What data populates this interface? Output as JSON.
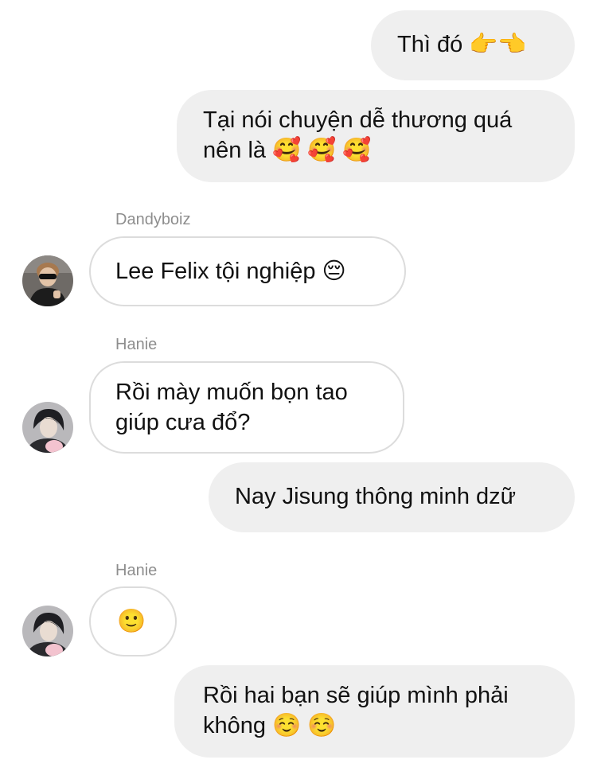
{
  "messages": [
    {
      "id": "m1",
      "direction": "outgoing",
      "lines": [
        "Thì đó 👉👈"
      ]
    },
    {
      "id": "m2",
      "direction": "outgoing",
      "lines": [
        "Tại nói chuyện dễ thương quá",
        "nên là 🥰 🥰 🥰"
      ]
    },
    {
      "id": "m3",
      "direction": "incoming",
      "sender": "Dandyboiz",
      "lines": [
        "Lee Felix tội nghiệp 😔"
      ]
    },
    {
      "id": "m4",
      "direction": "incoming",
      "sender": "Hanie",
      "lines": [
        "Rồi mày muốn bọn tao",
        "giúp cưa đổ?"
      ]
    },
    {
      "id": "m5",
      "direction": "outgoing",
      "lines": [
        "Nay Jisung thông minh dzữ"
      ]
    },
    {
      "id": "m6",
      "direction": "incoming",
      "sender": "Hanie",
      "lines": [
        "🙂"
      ]
    },
    {
      "id": "m7",
      "direction": "outgoing",
      "lines": [
        "Rồi hai bạn sẽ giúp mình phải",
        "không ☺️ ☺️"
      ]
    }
  ],
  "colors": {
    "outgoing_bubble": "#efefef",
    "incoming_border": "#dcdcdc",
    "sender_name": "#8e8e8e",
    "text": "#111111"
  }
}
